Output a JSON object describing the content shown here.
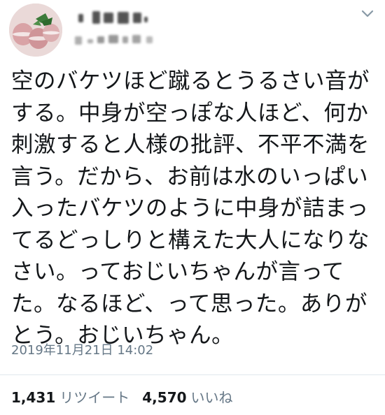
{
  "author": {
    "avatar_icon": "macaron-avatar-icon",
    "display_name_redacted": true,
    "handle_redacted": true
  },
  "menu": {
    "icon": "chevron-down-icon"
  },
  "tweet": {
    "text": "空のバケツほど蹴るとうるさい音がする。中身が空っぽな人ほど、何か刺激すると人様の批評、不平不満を言う。だから、お前は水のいっぱい入ったバケツのように中身が詰まってるどっしりと構えた大人になりなさい。っておじいちゃんが言ってた。なるほど、って思った。ありがとう。おじいちゃん。",
    "timestamp": "2019年11月21日 14:02"
  },
  "stats": {
    "retweets": {
      "count": "1,431",
      "label": "リツイート"
    },
    "likes": {
      "count": "4,570",
      "label": "いいね"
    }
  },
  "colors": {
    "text": "#14171a",
    "secondary_text": "#657786",
    "divider": "#e1e8ed",
    "background": "#ffffff"
  }
}
